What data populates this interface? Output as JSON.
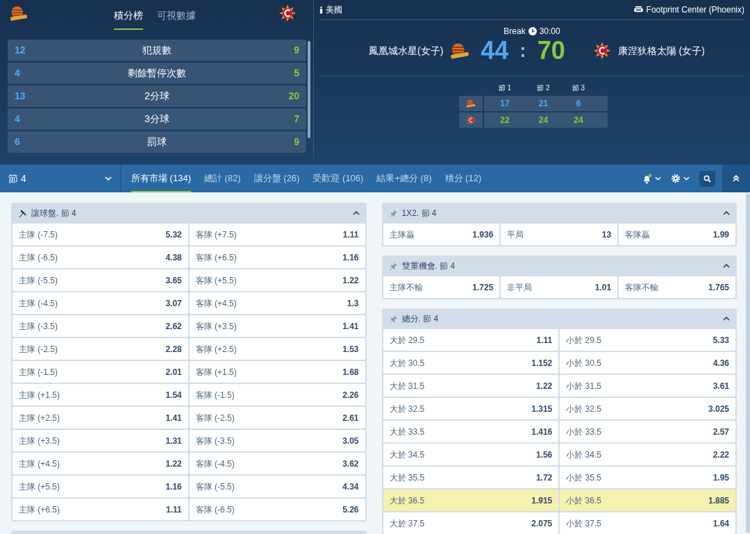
{
  "scoreboard": {
    "tabs": [
      {
        "label": "積分榜",
        "selected": true
      },
      {
        "label": "可視數據",
        "selected": false
      }
    ],
    "stats": [
      {
        "home": "12",
        "label": "犯規數",
        "away": "9"
      },
      {
        "home": "4",
        "label": "剩餘暫停次數",
        "away": "5"
      },
      {
        "home": "13",
        "label": "2分球",
        "away": "20"
      },
      {
        "home": "4",
        "label": "3分球",
        "away": "7"
      },
      {
        "home": "6",
        "label": "罰球",
        "away": "9"
      }
    ],
    "country": "美國",
    "venue": "Footprint Center (Phoenix)",
    "status": "Break",
    "clock": "30:00",
    "home_team": "鳳凰城水星(女子)",
    "away_team": "康涅狄格太陽 (女子)",
    "home_score": "44",
    "separator": ":",
    "away_score": "70",
    "periods": {
      "headers": [
        "節 1",
        "節 2",
        "節 3"
      ],
      "home": [
        "17",
        "21",
        "6"
      ],
      "away": [
        "22",
        "24",
        "24"
      ]
    }
  },
  "nav": {
    "period": "節 4",
    "tabs": [
      {
        "label": "所有市場 (134)",
        "selected": true
      },
      {
        "label": "總計 (82)",
        "selected": false
      },
      {
        "label": "讓分盤 (26)",
        "selected": false
      },
      {
        "label": "受歡迎 (106)",
        "selected": false
      },
      {
        "label": "結果+總分 (8)",
        "selected": false
      },
      {
        "label": "積分 (12)",
        "selected": false
      }
    ]
  },
  "markets": [
    {
      "title": "讓球盤. 節 4",
      "rows": [
        [
          {
            "label": "主隊 (-7.5)",
            "odds": "5.32"
          },
          {
            "label": "客隊 (+7.5)",
            "odds": "1.11"
          }
        ],
        [
          {
            "label": "主隊 (-6.5)",
            "odds": "4.38"
          },
          {
            "label": "客隊 (+6.5)",
            "odds": "1.16"
          }
        ],
        [
          {
            "label": "主隊 (-5.5)",
            "odds": "3.65"
          },
          {
            "label": "客隊 (+5.5)",
            "odds": "1.22"
          }
        ],
        [
          {
            "label": "主隊 (-4.5)",
            "odds": "3.07"
          },
          {
            "label": "客隊 (+4.5)",
            "odds": "1.3"
          }
        ],
        [
          {
            "label": "主隊 (-3.5)",
            "odds": "2.62"
          },
          {
            "label": "客隊 (+3.5)",
            "odds": "1.41"
          }
        ],
        [
          {
            "label": "主隊 (-2.5)",
            "odds": "2.28"
          },
          {
            "label": "客隊 (+2.5)",
            "odds": "1.53"
          }
        ],
        [
          {
            "label": "主隊 (-1.5)",
            "odds": "2.01"
          },
          {
            "label": "客隊 (+1.5)",
            "odds": "1.68"
          }
        ],
        [
          {
            "label": "主隊 (+1.5)",
            "odds": "1.54"
          },
          {
            "label": "客隊 (-1.5)",
            "odds": "2.26"
          }
        ],
        [
          {
            "label": "主隊 (+2.5)",
            "odds": "1.41"
          },
          {
            "label": "客隊 (-2.5)",
            "odds": "2.61"
          }
        ],
        [
          {
            "label": "主隊 (+3.5)",
            "odds": "1.31"
          },
          {
            "label": "客隊 (-3.5)",
            "odds": "3.05"
          }
        ],
        [
          {
            "label": "主隊 (+4.5)",
            "odds": "1.22"
          },
          {
            "label": "客隊 (-4.5)",
            "odds": "3.62"
          }
        ],
        [
          {
            "label": "主隊 (+5.5)",
            "odds": "1.16"
          },
          {
            "label": "客隊 (-5.5)",
            "odds": "4.34"
          }
        ],
        [
          {
            "label": "主隊 (+6.5)",
            "odds": "1.11"
          },
          {
            "label": "客隊 (-6.5)",
            "odds": "5.26"
          }
        ]
      ]
    },
    {
      "title": "1X2. 節 4",
      "rows": [
        [
          {
            "label": "主隊贏",
            "odds": "1.936"
          },
          {
            "label": "平局",
            "odds": "13"
          },
          {
            "label": "客隊贏",
            "odds": "1.99"
          }
        ]
      ]
    },
    {
      "title": "雙重機會. 節 4",
      "rows": [
        [
          {
            "label": "主隊不輸",
            "odds": "1.725"
          },
          {
            "label": "非平局",
            "odds": "1.01"
          },
          {
            "label": "客隊不輸",
            "odds": "1.765"
          }
        ]
      ]
    },
    {
      "title": "總分. 節 4",
      "rows": [
        [
          {
            "label": "大於 29.5",
            "odds": "1.11",
            "selected": false
          },
          {
            "label": "小於 29.5",
            "odds": "5.33",
            "selected": false
          }
        ],
        [
          {
            "label": "大於 30.5",
            "odds": "1.152",
            "selected": false
          },
          {
            "label": "小於 30.5",
            "odds": "4.36",
            "selected": false
          }
        ],
        [
          {
            "label": "大於 31.5",
            "odds": "1.22",
            "selected": false
          },
          {
            "label": "小於 31.5",
            "odds": "3.61",
            "selected": false
          }
        ],
        [
          {
            "label": "大於 32.5",
            "odds": "1.315",
            "selected": false
          },
          {
            "label": "小於 32.5",
            "odds": "3.025",
            "selected": false
          }
        ],
        [
          {
            "label": "大於 33.5",
            "odds": "1.416",
            "selected": false
          },
          {
            "label": "小於 33.5",
            "odds": "2.57",
            "selected": false
          }
        ],
        [
          {
            "label": "大於 34.5",
            "odds": "1.56",
            "selected": false
          },
          {
            "label": "小於 34.5",
            "odds": "2.22",
            "selected": false
          }
        ],
        [
          {
            "label": "大於 35.5",
            "odds": "1.72",
            "selected": false
          },
          {
            "label": "小於 35.5",
            "odds": "1.95",
            "selected": false
          }
        ],
        [
          {
            "label": "大於 36.5",
            "odds": "1.915",
            "selected": true
          },
          {
            "label": "小於 36.5",
            "odds": "1.885",
            "selected": true
          }
        ],
        [
          {
            "label": "大於 37.5",
            "odds": "2.075",
            "selected": false
          },
          {
            "label": "小於 37.5",
            "odds": "1.64",
            "selected": false
          }
        ]
      ]
    }
  ]
}
